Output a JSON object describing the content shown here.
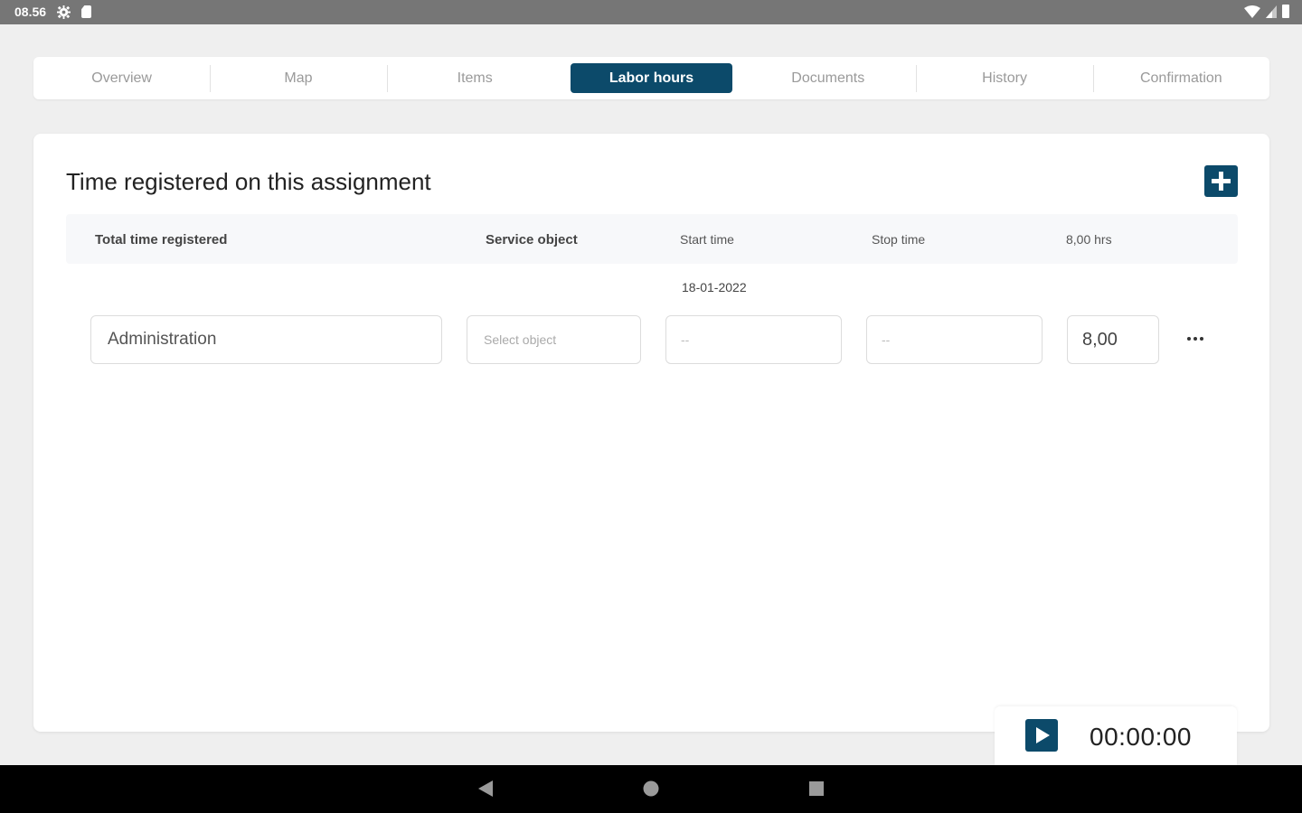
{
  "status_bar": {
    "time": "08.56",
    "icons": [
      "gear-icon",
      "sd-card-icon",
      "wifi-icon",
      "signal-icon",
      "battery-icon"
    ]
  },
  "tabs": [
    {
      "label": "Overview",
      "active": false
    },
    {
      "label": "Map",
      "active": false
    },
    {
      "label": "Items",
      "active": false
    },
    {
      "label": "Labor hours",
      "active": true
    },
    {
      "label": "Documents",
      "active": false
    },
    {
      "label": "History",
      "active": false
    },
    {
      "label": "Confirmation",
      "active": false
    }
  ],
  "card": {
    "title": "Time registered on this assignment",
    "add_icon": "plus-icon"
  },
  "table": {
    "headers": {
      "total": "Total time registered",
      "service_object": "Service object",
      "start_time": "Start time",
      "stop_time": "Stop time",
      "hours_total": "8,00 hrs"
    },
    "date": "18-01-2022",
    "row": {
      "activity": "Administration",
      "service_object_placeholder": "Select object",
      "start_time": "--",
      "stop_time": "--",
      "hours": "8,00",
      "more_label": "···"
    }
  },
  "timer": {
    "value": "00:00:00",
    "play_icon": "play-icon"
  },
  "colors": {
    "accent": "#0c4a6a",
    "status_bar": "#767676",
    "background": "#efefef"
  },
  "nav_bar": {
    "icons": [
      "back-icon",
      "home-icon",
      "recents-icon"
    ]
  }
}
